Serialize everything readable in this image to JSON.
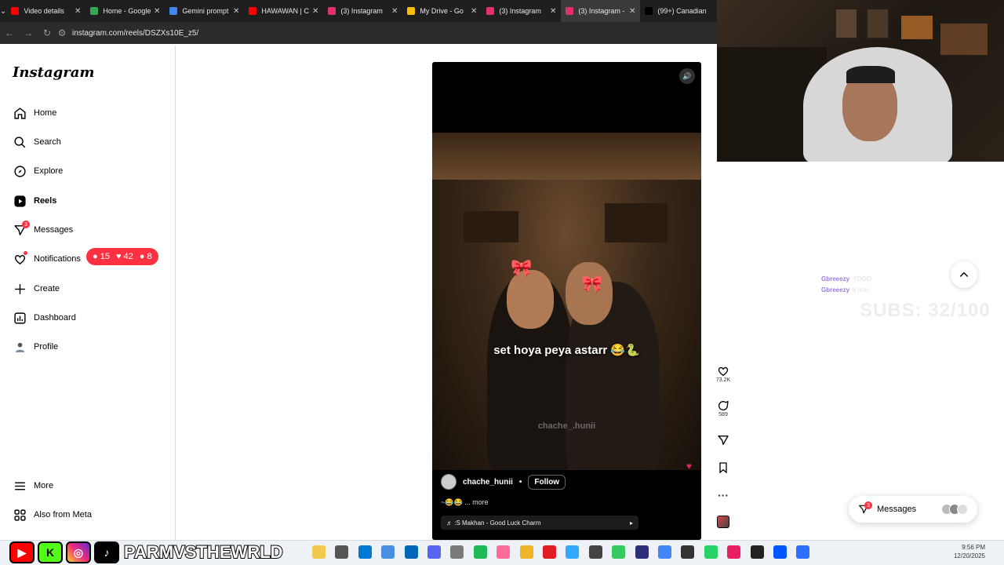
{
  "tabs": [
    {
      "label": "Video details",
      "color": "#ff0000"
    },
    {
      "label": "Home - Google",
      "color": "#34a853"
    },
    {
      "label": "Gemini prompt",
      "color": "#4285f4"
    },
    {
      "label": "HAWAWAN | C",
      "color": "#ff0000"
    },
    {
      "label": "(3) Instagram",
      "color": "#e1306c"
    },
    {
      "label": "My Drive - Go",
      "color": "#fbbc04"
    },
    {
      "label": "(3) Instagram",
      "color": "#e1306c"
    },
    {
      "label": "(3) Instagram -",
      "color": "#e1306c"
    },
    {
      "label": "(99+) Canadian",
      "color": "#000000"
    }
  ],
  "address": {
    "url": "instagram.com/reels/DSZXs10E_z5/"
  },
  "sidebar": {
    "logo": "Instagram",
    "items": [
      {
        "label": "Home",
        "icon": "home-icon"
      },
      {
        "label": "Search",
        "icon": "search-icon"
      },
      {
        "label": "Explore",
        "icon": "compass-icon"
      },
      {
        "label": "Reels",
        "icon": "reels-icon"
      },
      {
        "label": "Messages",
        "icon": "messenger-icon",
        "badge": "3"
      },
      {
        "label": "Notifications",
        "icon": "heart-icon"
      },
      {
        "label": "Create",
        "icon": "plus-icon"
      },
      {
        "label": "Dashboard",
        "icon": "dashboard-icon"
      },
      {
        "label": "Profile",
        "icon": "profile-avatar"
      }
    ],
    "more": "More",
    "meta": "Also from Meta"
  },
  "notif_pill": {
    "comments": "15",
    "likes": "42",
    "follows": "8"
  },
  "reel": {
    "caption": "set hoya peya astarr 😂🐍",
    "watermark": "chache_.hunii",
    "author": "chache_hunii",
    "separator": "•",
    "follow": "Follow",
    "desc": "~😂😂 ... more",
    "music": "♬ :S Makhan - Good Luck Charm"
  },
  "actions": {
    "likes": "73.2K",
    "comments": "589"
  },
  "chat": [
    {
      "user": "Gbreeezy",
      "msg": "YOOO"
    },
    {
      "user": "Gbreeezy",
      "msg": "k nnn"
    }
  ],
  "subs": "SUBS: 32/100",
  "messages_pill": {
    "label": "Messages",
    "badge": "3"
  },
  "brand": {
    "name": "PARMVSTHEWRLD"
  },
  "clock": {
    "time": "9:56 PM",
    "date": "12/20/2025"
  }
}
